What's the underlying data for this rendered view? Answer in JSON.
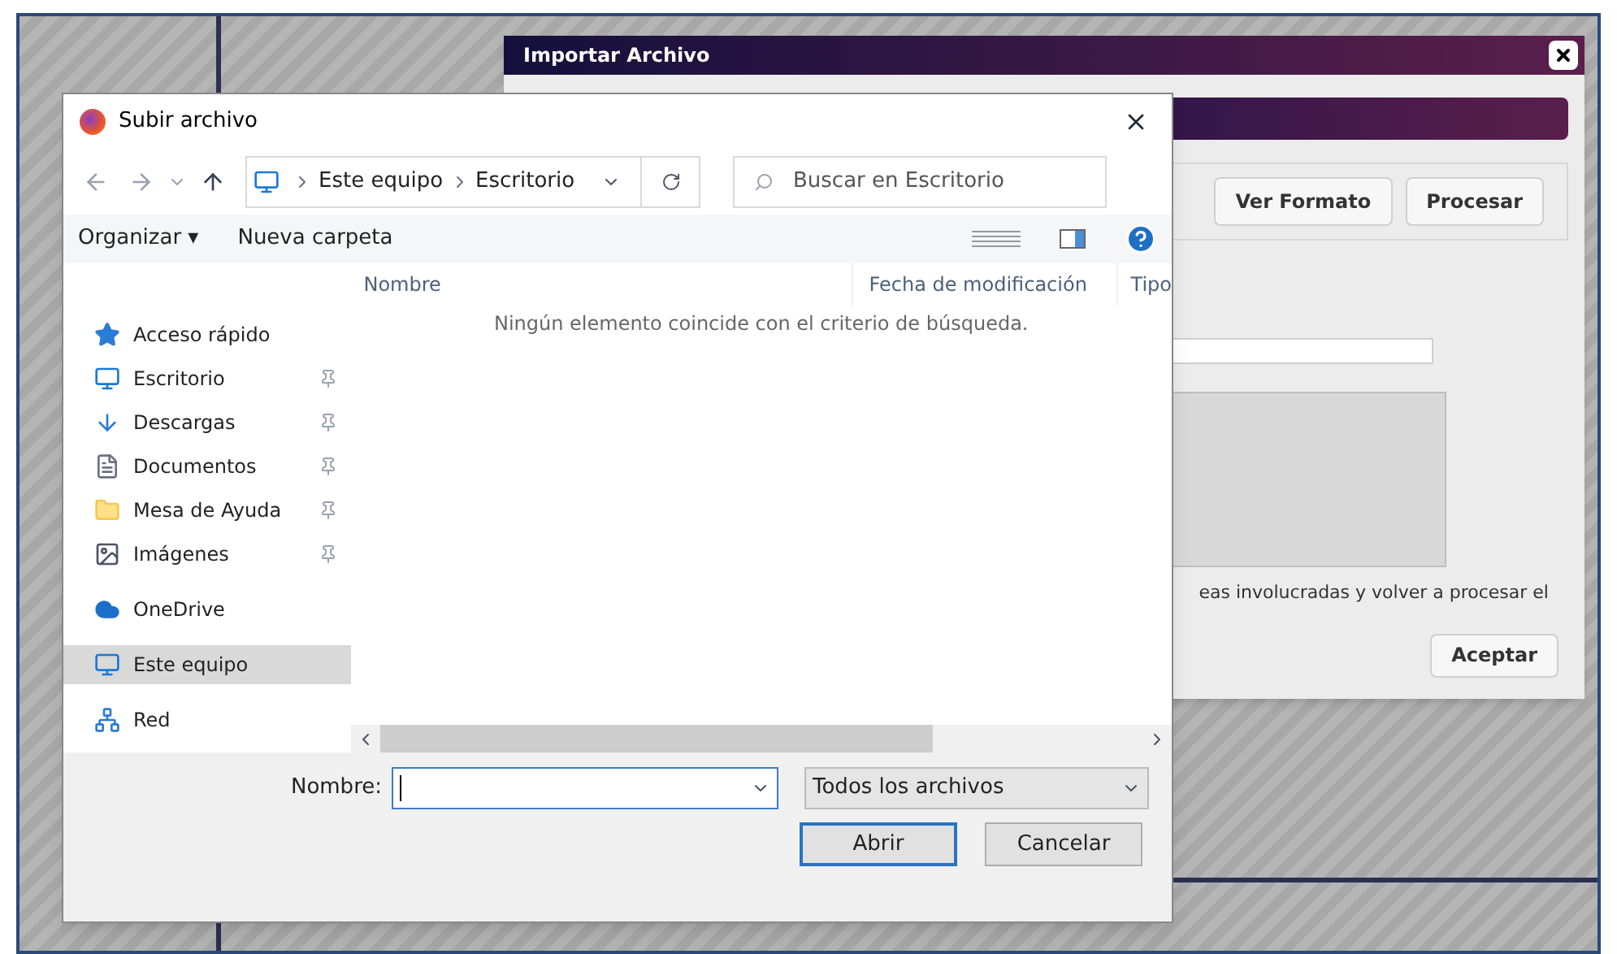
{
  "background_dialog": {
    "title": "Importar Archivo",
    "buttons": [
      "Ver Formato",
      "Procesar"
    ],
    "message": "eas involucradas y volver a procesar el",
    "accept_button": "Aceptar"
  },
  "file_dialog": {
    "title": "Subir archivo",
    "breadcrumb": [
      "Este equipo",
      "Escritorio"
    ],
    "search": {
      "placeholder": "Buscar en Escritorio"
    },
    "toolbar": [
      "Organizar ▾",
      "Nueva carpeta"
    ],
    "sidebar": [
      {
        "label": "Acceso rápido",
        "kind": "star",
        "selected": false,
        "children": [
          {
            "label": "Escritorio",
            "kind": "desktop",
            "pinned": true,
            "selected": false
          },
          {
            "label": "Descargas",
            "kind": "download",
            "pinned": true,
            "selected": false
          },
          {
            "label": "Documentos",
            "kind": "document",
            "pinned": true,
            "selected": false
          },
          {
            "label": "Mesa de Ayuda",
            "kind": "folder",
            "pinned": true,
            "selected": false
          },
          {
            "label": "Imágenes",
            "kind": "image",
            "pinned": true,
            "selected": false
          }
        ]
      },
      {
        "label": "OneDrive",
        "kind": "cloud",
        "selected": false
      },
      {
        "label": "Este equipo",
        "kind": "computer",
        "selected": true
      },
      {
        "label": "Red",
        "kind": "network",
        "selected": false
      }
    ],
    "columns": [
      "Nombre",
      "Fecha de modificación",
      "Tipo"
    ],
    "empty_message": "Ningún elemento coincide con el criterio de búsqueda.",
    "filename_label": "Nombre:",
    "file_type": "Todos los archivos",
    "buttons": [
      "Abrir",
      "Cancelar"
    ]
  }
}
